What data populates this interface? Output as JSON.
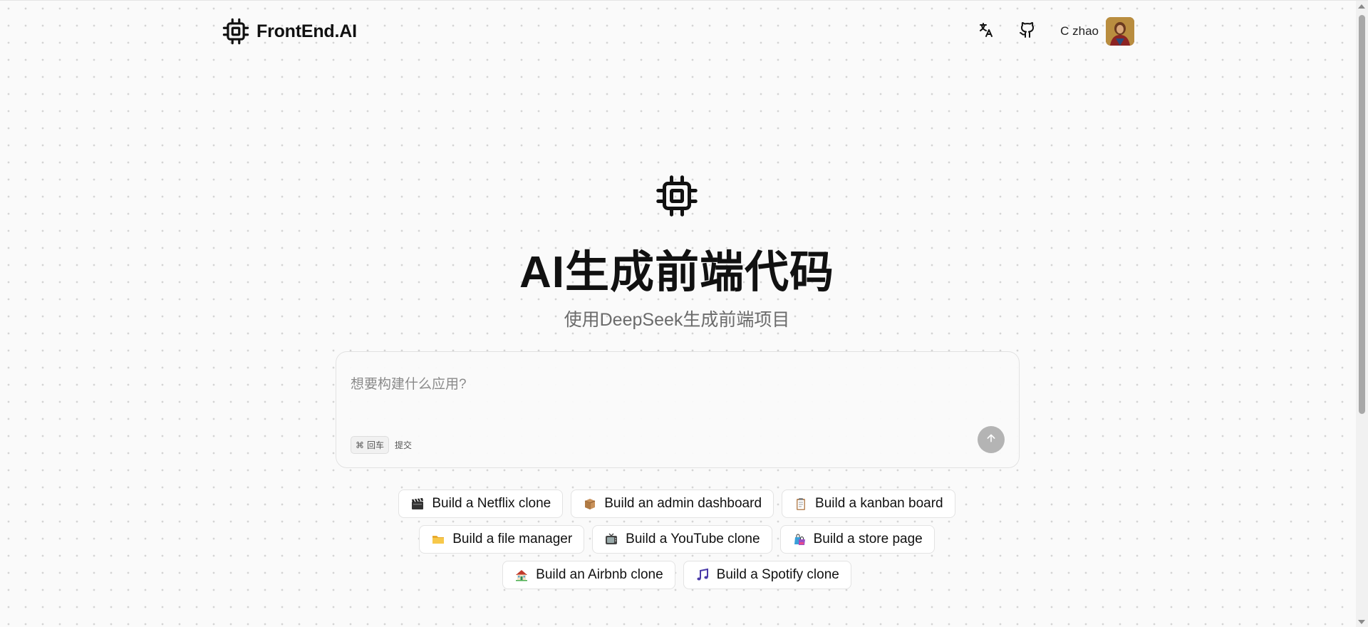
{
  "header": {
    "brand_name": "FrontEnd.AI",
    "brand_icon": "cpu-chip-icon",
    "translate_icon": "translate-icon",
    "github_icon": "github-icon",
    "user_name": "C zhao"
  },
  "hero": {
    "icon": "cpu-chip-icon",
    "title": "AI生成前端代码",
    "subtitle": "使用DeepSeek生成前端项目"
  },
  "prompt": {
    "placeholder": "想要构建什么应用?",
    "value": "",
    "shortcut_key": "⌘",
    "shortcut_label": "回车",
    "shortcut_action": "提交",
    "submit_icon": "arrow-up-icon"
  },
  "suggestions": {
    "row1": [
      {
        "label": "Build a Netflix clone",
        "icon": "clapper-board-icon"
      },
      {
        "label": "Build an admin dashboard",
        "icon": "package-box-icon"
      },
      {
        "label": "Build a kanban board",
        "icon": "clipboard-icon"
      }
    ],
    "row2": [
      {
        "label": "Build a file manager",
        "icon": "folder-icon"
      },
      {
        "label": "Build a YouTube clone",
        "icon": "television-icon"
      },
      {
        "label": "Build a store page",
        "icon": "shopping-bags-icon"
      }
    ],
    "row3": [
      {
        "label": "Build an Airbnb clone",
        "icon": "house-icon"
      },
      {
        "label": "Build a Spotify clone",
        "icon": "music-note-icon"
      }
    ]
  },
  "colors": {
    "background": "#fafafa",
    "dot": "#d4d4d4",
    "submit_disabled": "#b4b4b4",
    "text": "#111111"
  }
}
